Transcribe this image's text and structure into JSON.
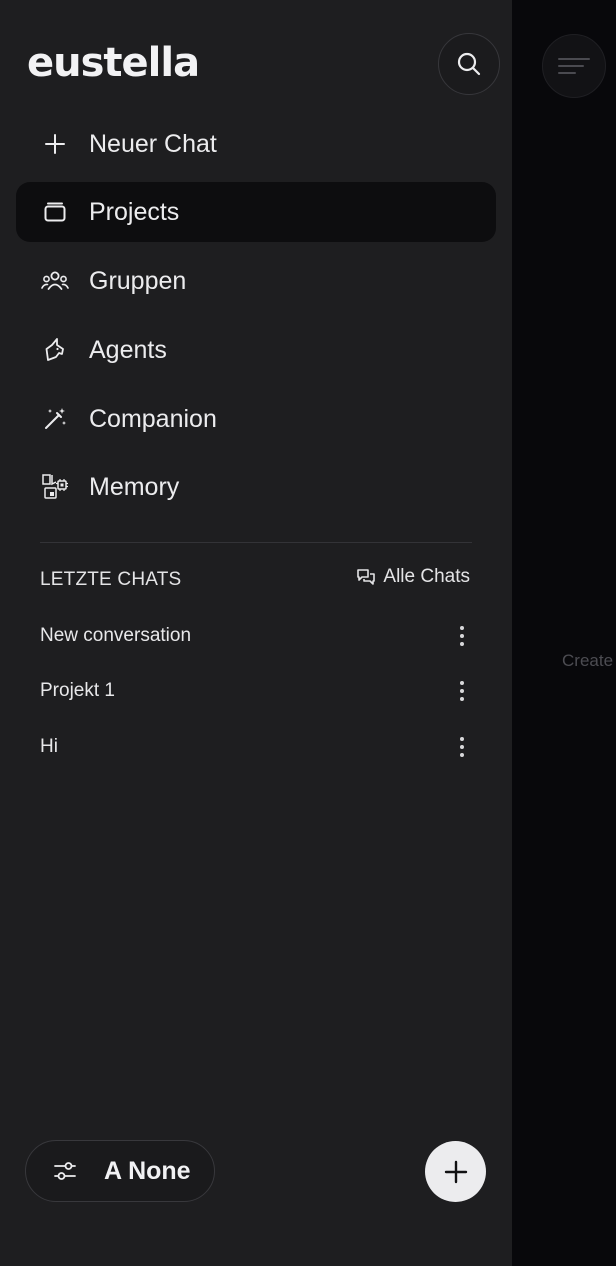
{
  "app": {
    "logo": "eustella"
  },
  "header": {
    "search_icon": "search-icon",
    "menu_icon": "menu-icon"
  },
  "nav": {
    "items": [
      {
        "label": "Neuer Chat",
        "icon": "plus-icon",
        "active": false
      },
      {
        "label": "Projects",
        "icon": "folder-icon",
        "active": true
      },
      {
        "label": "Gruppen",
        "icon": "group-icon",
        "active": false
      },
      {
        "label": "Agents",
        "icon": "agent-icon",
        "active": false
      },
      {
        "label": "Companion",
        "icon": "magic-wand-icon",
        "active": false
      },
      {
        "label": "Memory",
        "icon": "memory-icon",
        "active": false
      }
    ]
  },
  "recent": {
    "title": "LETZTE CHATS",
    "all_chats_label": "Alle Chats",
    "chats": [
      {
        "title": "New conversation"
      },
      {
        "title": "Projekt 1"
      },
      {
        "title": "Hi"
      }
    ]
  },
  "footer": {
    "model_label": "A None",
    "new_button_icon": "plus-icon"
  },
  "main": {
    "hint_text": "Create"
  },
  "colors": {
    "sidebar_bg": "#1e1e20",
    "main_bg": "#08080b",
    "active_item_bg": "#0d0d0f",
    "text": "#ececee"
  }
}
